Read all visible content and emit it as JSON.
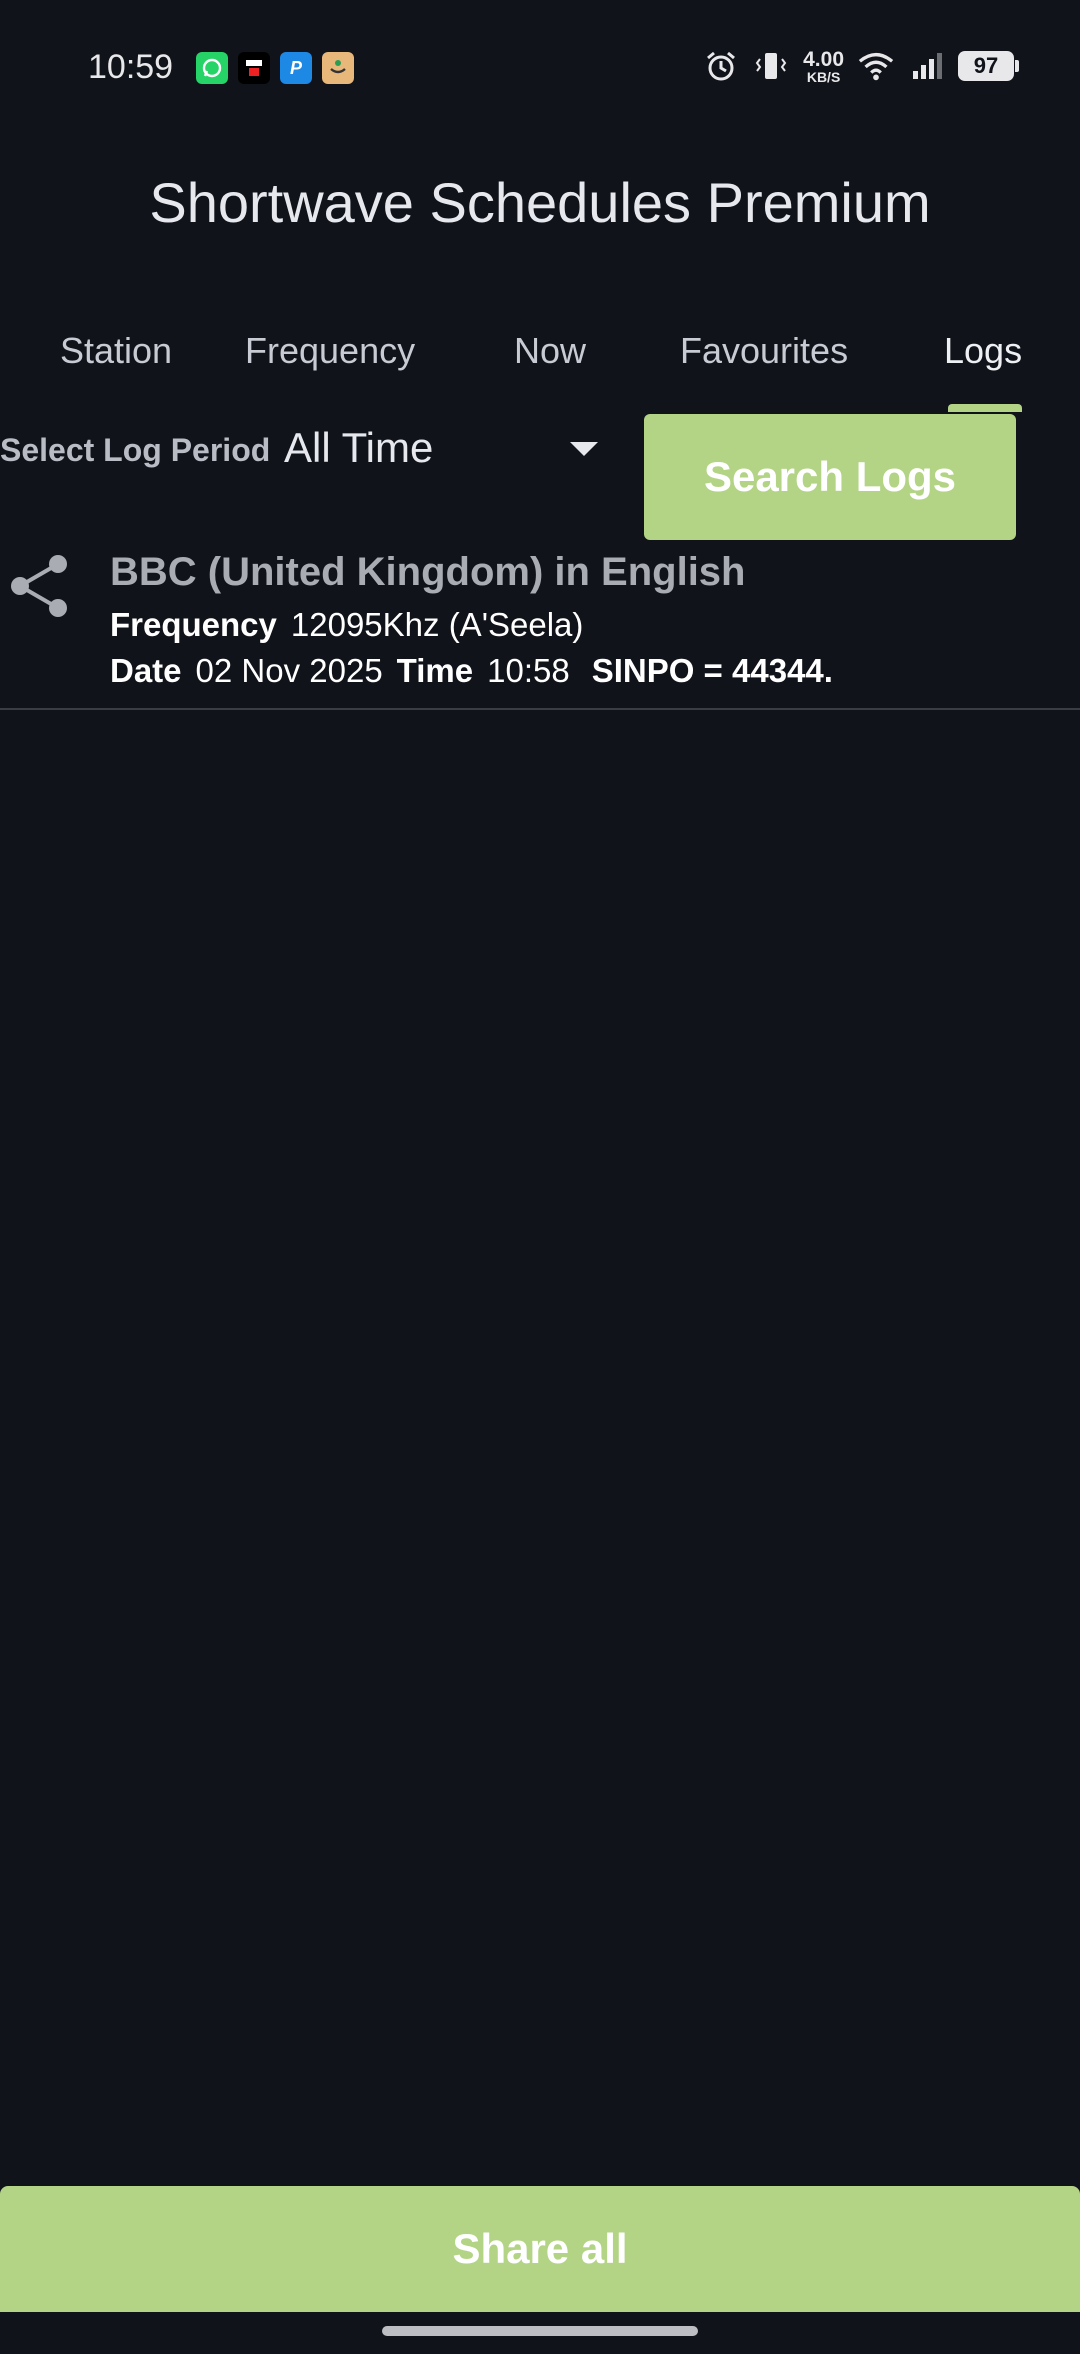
{
  "status_bar": {
    "time": "10:59",
    "net_speed_value": "4.00",
    "net_speed_unit": "KB/S",
    "battery": "97",
    "notification_icons": [
      "whatsapp-icon",
      "news-app-icon",
      "paytm-icon",
      "shopping-app-icon"
    ],
    "system_icons": [
      "alarm-icon",
      "vibrate-icon",
      "wifi-icon",
      "signal-icon",
      "battery-icon"
    ]
  },
  "app": {
    "title": "Shortwave Schedules Premium"
  },
  "tabs": [
    {
      "label": "Station"
    },
    {
      "label": "Frequency"
    },
    {
      "label": "Now"
    },
    {
      "label": "Favourites"
    },
    {
      "label": "Logs",
      "active": true
    }
  ],
  "filter": {
    "period_label": "Select Log Period",
    "period_value": "All Time",
    "search_button": "Search Logs"
  },
  "logs": [
    {
      "station": "BBC (United Kingdom) in English",
      "frequency_label": "Frequency",
      "frequency_value": "12095Khz (A'Seela)",
      "date_label": "Date",
      "date_value": "02 Nov 2025",
      "time_label": "Time",
      "time_value": "10:58",
      "sinpo": "SINPO = 44344."
    }
  ],
  "footer": {
    "share_all": "Share all"
  },
  "colors": {
    "background": "#10131a",
    "accent": "#b3d385",
    "muted_text": "#a9acb3"
  }
}
